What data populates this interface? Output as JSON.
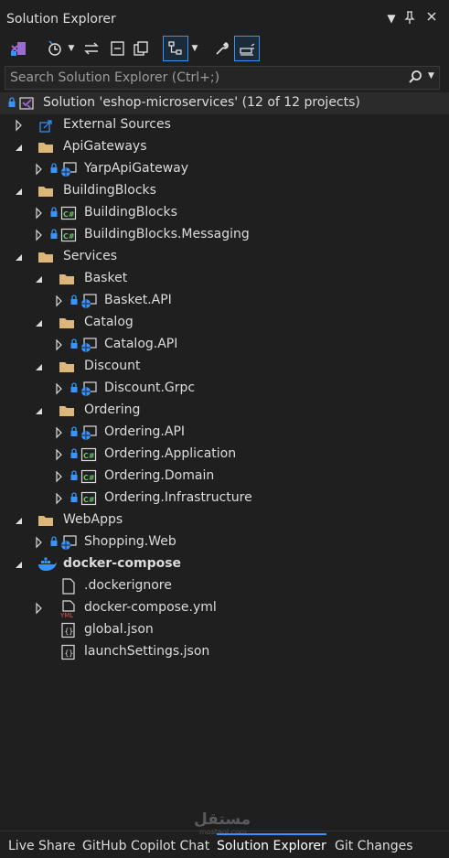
{
  "window": {
    "title": "Solution Explorer"
  },
  "search": {
    "placeholder": "Search Solution Explorer (Ctrl+;)"
  },
  "solution": {
    "label": "Solution 'eshop-microservices' (12 of 12 projects)"
  },
  "tree": {
    "external_sources": "External Sources",
    "apigateways": "ApiGateways",
    "yarp": "YarpApiGateway",
    "buildingblocks_folder": "BuildingBlocks",
    "buildingblocks": "BuildingBlocks",
    "buildingblocks_messaging": "BuildingBlocks.Messaging",
    "services": "Services",
    "basket": "Basket",
    "basket_api": "Basket.API",
    "catalog": "Catalog",
    "catalog_api": "Catalog.API",
    "discount": "Discount",
    "discount_grpc": "Discount.Grpc",
    "ordering": "Ordering",
    "ordering_api": "Ordering.API",
    "ordering_application": "Ordering.Application",
    "ordering_domain": "Ordering.Domain",
    "ordering_infrastructure": "Ordering.Infrastructure",
    "webapps": "WebApps",
    "shopping_web": "Shopping.Web",
    "docker_compose": "docker-compose",
    "dockerignore": ".dockerignore",
    "docker_compose_yml": "docker-compose.yml",
    "global_json": "global.json",
    "launch_settings": "launchSettings.json"
  },
  "bottom_tabs": [
    "Live Share",
    "GitHub Copilot Chat",
    "Solution Explorer",
    "Git Changes"
  ],
  "watermark": {
    "arabic": "مستقل",
    "latin": "mostaql.com"
  },
  "colors": {
    "accent": "#3794ff",
    "background": "#1f1f1f",
    "folder": "#dcb67a"
  }
}
